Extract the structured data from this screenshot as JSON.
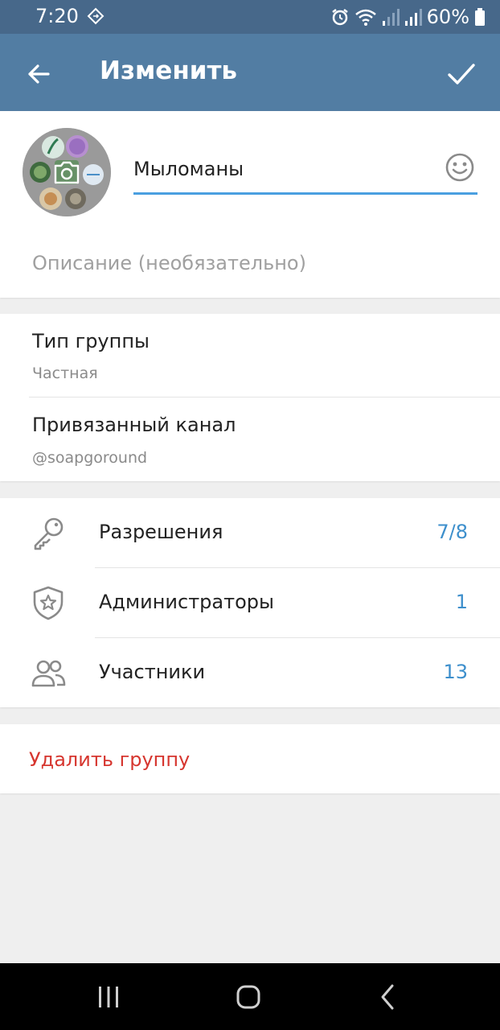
{
  "status_bar": {
    "time": "7:20",
    "battery": "60%",
    "icons": [
      "sync-icon",
      "alarm-icon",
      "wifi-icon",
      "signal-icon",
      "signal-icon",
      "battery-icon"
    ]
  },
  "app_bar": {
    "title": "Изменить",
    "back_icon": "arrow-left-icon",
    "done_icon": "checkmark-icon",
    "background": "#527da3"
  },
  "group": {
    "name": "Мыломаны",
    "description_placeholder": "Описание (необязательно)"
  },
  "group_type": {
    "title": "Тип группы",
    "value": "Частная"
  },
  "linked_channel": {
    "title": "Привязанный канал",
    "value": "@soapgoround"
  },
  "settings": [
    {
      "icon": "key-icon",
      "label": "Разрешения",
      "value": "7/8"
    },
    {
      "icon": "shield-star-icon",
      "label": "Администраторы",
      "value": "1"
    },
    {
      "icon": "users-icon",
      "label": "Участники",
      "value": "13"
    }
  ],
  "delete": {
    "label": "Удалить группу",
    "color": "#d6362f"
  },
  "accent": "#3d8fcc"
}
